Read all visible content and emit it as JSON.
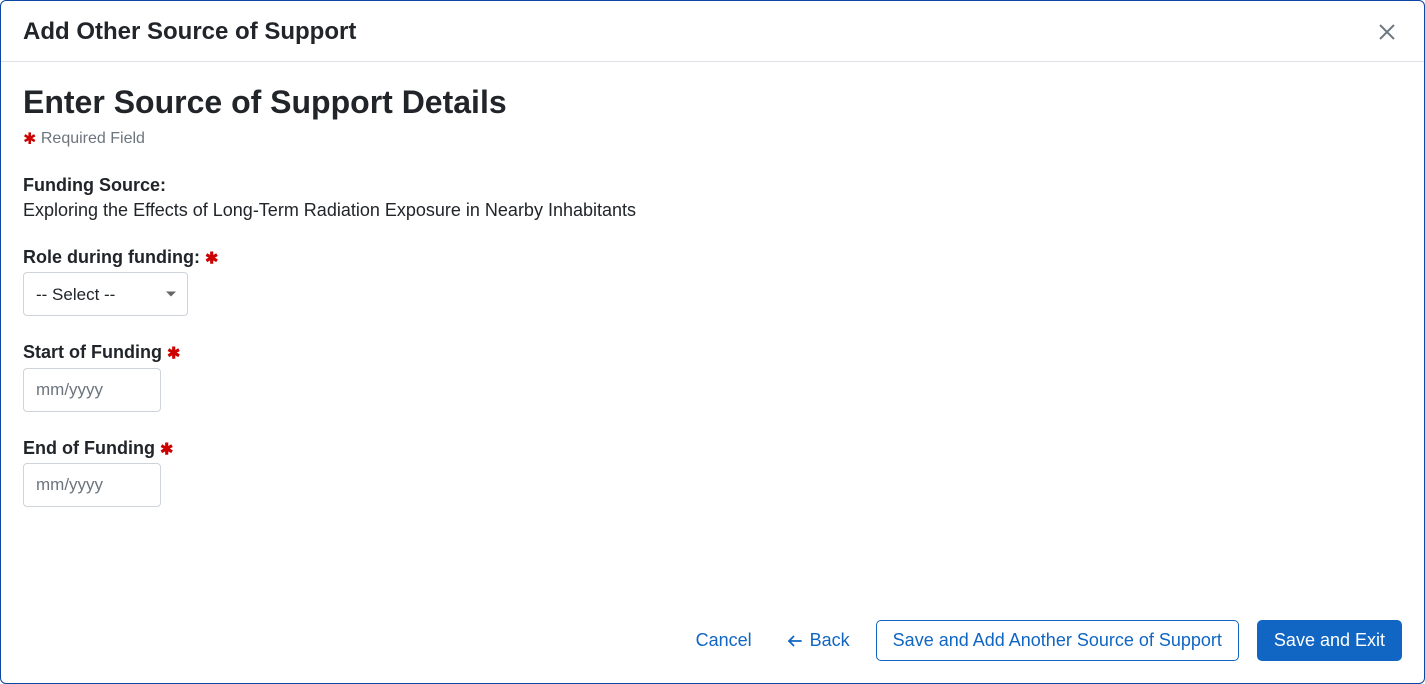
{
  "header": {
    "title": "Add Other Source of Support"
  },
  "page": {
    "heading": "Enter Source of Support Details",
    "required_note": "Required Field"
  },
  "fields": {
    "funding_source": {
      "label": "Funding Source:",
      "value": "Exploring the Effects of Long-Term Radiation Exposure in Nearby Inhabitants"
    },
    "role": {
      "label": "Role during funding:",
      "selected": "-- Select --"
    },
    "start": {
      "label": "Start of Funding",
      "placeholder": "mm/yyyy",
      "value": ""
    },
    "end": {
      "label": "End of Funding",
      "placeholder": "mm/yyyy",
      "value": ""
    }
  },
  "footer": {
    "cancel": "Cancel",
    "back": "Back",
    "save_add": "Save and Add Another Source of Support",
    "save_exit": "Save and Exit"
  }
}
